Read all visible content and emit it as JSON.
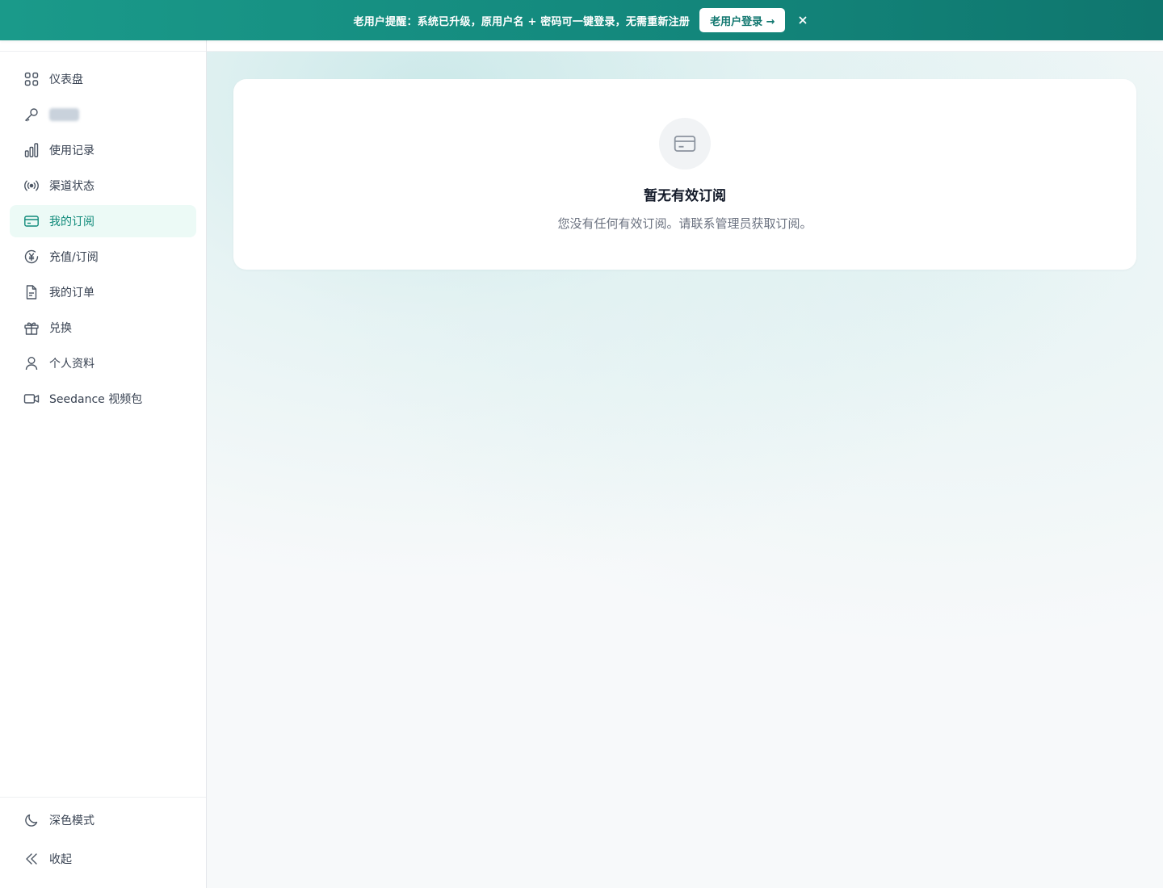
{
  "banner": {
    "text": "老用户提醒：系统已升级，原用户名 + 密码可一键登录，无需重新注册",
    "login_button": "老用户登录 →",
    "close_icon": "close-icon"
  },
  "sidebar": {
    "items": [
      {
        "label": "仪表盘",
        "icon": "dashboard-grid-icon"
      },
      {
        "label": "",
        "icon": "key-icon"
      },
      {
        "label": "使用记录",
        "icon": "bar-chart-icon"
      },
      {
        "label": "渠道状态",
        "icon": "signal-icon"
      },
      {
        "label": "我的订阅",
        "icon": "credit-card-icon"
      },
      {
        "label": "充值/订阅",
        "icon": "yen-coin-icon"
      },
      {
        "label": "我的订单",
        "icon": "document-icon"
      },
      {
        "label": "兑换",
        "icon": "gift-icon"
      },
      {
        "label": "个人资料",
        "icon": "user-icon"
      },
      {
        "label": "Seedance 视频包",
        "icon": "video-icon"
      }
    ],
    "active_item": "我的订阅",
    "footer": {
      "dark_mode": "深色模式",
      "collapse": "收起"
    }
  },
  "main": {
    "empty_state": {
      "title": "暂无有效订阅",
      "description": "您没有任何有效订阅。请联系管理员获取订阅。",
      "icon": "credit-card-icon"
    }
  },
  "colors": {
    "accent": "#0f8a7a",
    "active_bg": "#ecfaf6",
    "banner": "#148a7e"
  }
}
